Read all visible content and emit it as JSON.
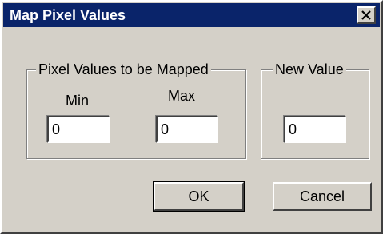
{
  "window": {
    "title": "Map Pixel Values",
    "close_icon": "close-icon"
  },
  "group_source": {
    "legend": "Pixel Values to be Mapped",
    "min_label": "Min",
    "max_label": "Max",
    "min_value": "0",
    "max_value": "0"
  },
  "group_target": {
    "legend": "New Value",
    "new_value": "0"
  },
  "buttons": {
    "ok_label": "OK",
    "cancel_label": "Cancel"
  },
  "colors": {
    "titlebar": "#0a246a",
    "face": "#d4d0c8",
    "title_text": "#ffffff"
  }
}
